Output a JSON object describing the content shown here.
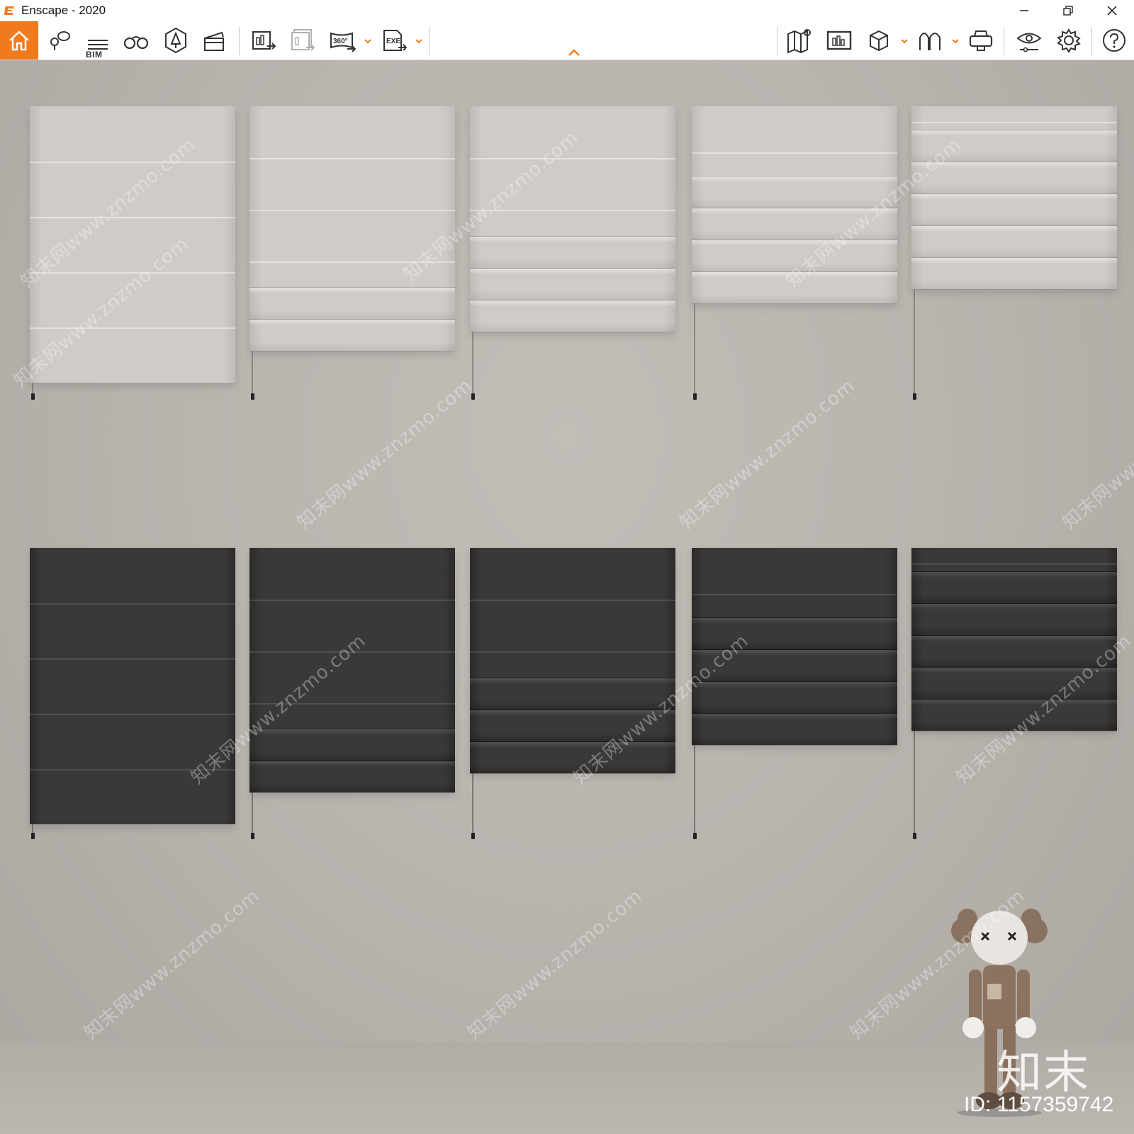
{
  "window": {
    "title": "Enscape - 2020",
    "controls": [
      "minimize",
      "restore",
      "close"
    ]
  },
  "toolbar": {
    "left_tools": [
      {
        "name": "home",
        "icon": "home-icon"
      },
      {
        "name": "views",
        "icon": "map-pin-chat-icon"
      },
      {
        "name": "bim",
        "icon": "bim-list-icon",
        "label": "BIM"
      },
      {
        "name": "binoculars",
        "icon": "binoculars-icon"
      },
      {
        "name": "atmosphere",
        "icon": "bell-tree-icon"
      },
      {
        "name": "video",
        "icon": "clapperboard-icon"
      },
      {
        "name": "export-image",
        "icon": "export-image-icon"
      },
      {
        "name": "batch-export",
        "icon": "batch-export-icon"
      },
      {
        "name": "export-panorama",
        "icon": "panorama-360-icon",
        "label": "360°"
      },
      {
        "name": "export-exe",
        "icon": "exe-export-icon",
        "label": "EXE"
      }
    ],
    "right_tools": [
      {
        "name": "map",
        "icon": "map-icon"
      },
      {
        "name": "capture",
        "icon": "capture-screen-icon"
      },
      {
        "name": "asset-library",
        "icon": "cube-icon"
      },
      {
        "name": "materials",
        "icon": "arches-icon"
      },
      {
        "name": "vr",
        "icon": "vr-headset-icon"
      },
      {
        "name": "visual-settings",
        "icon": "eye-icon"
      },
      {
        "name": "settings",
        "icon": "gear-icon"
      },
      {
        "name": "help",
        "icon": "help-icon"
      }
    ],
    "accent_color": "#f07b1e"
  },
  "scene": {
    "description_colors": {
      "wall": "#bcb6b1",
      "light_blind": "#cfcbc7",
      "dark_blind": "#3a3938"
    },
    "light_row_folds": [
      0,
      2,
      3,
      4,
      5
    ],
    "dark_row_folds": [
      0,
      2,
      3,
      4,
      5
    ]
  },
  "watermark": {
    "text": "知末网www.znzmo.com",
    "brand": "知末",
    "id_label": "ID: 1157359742"
  }
}
